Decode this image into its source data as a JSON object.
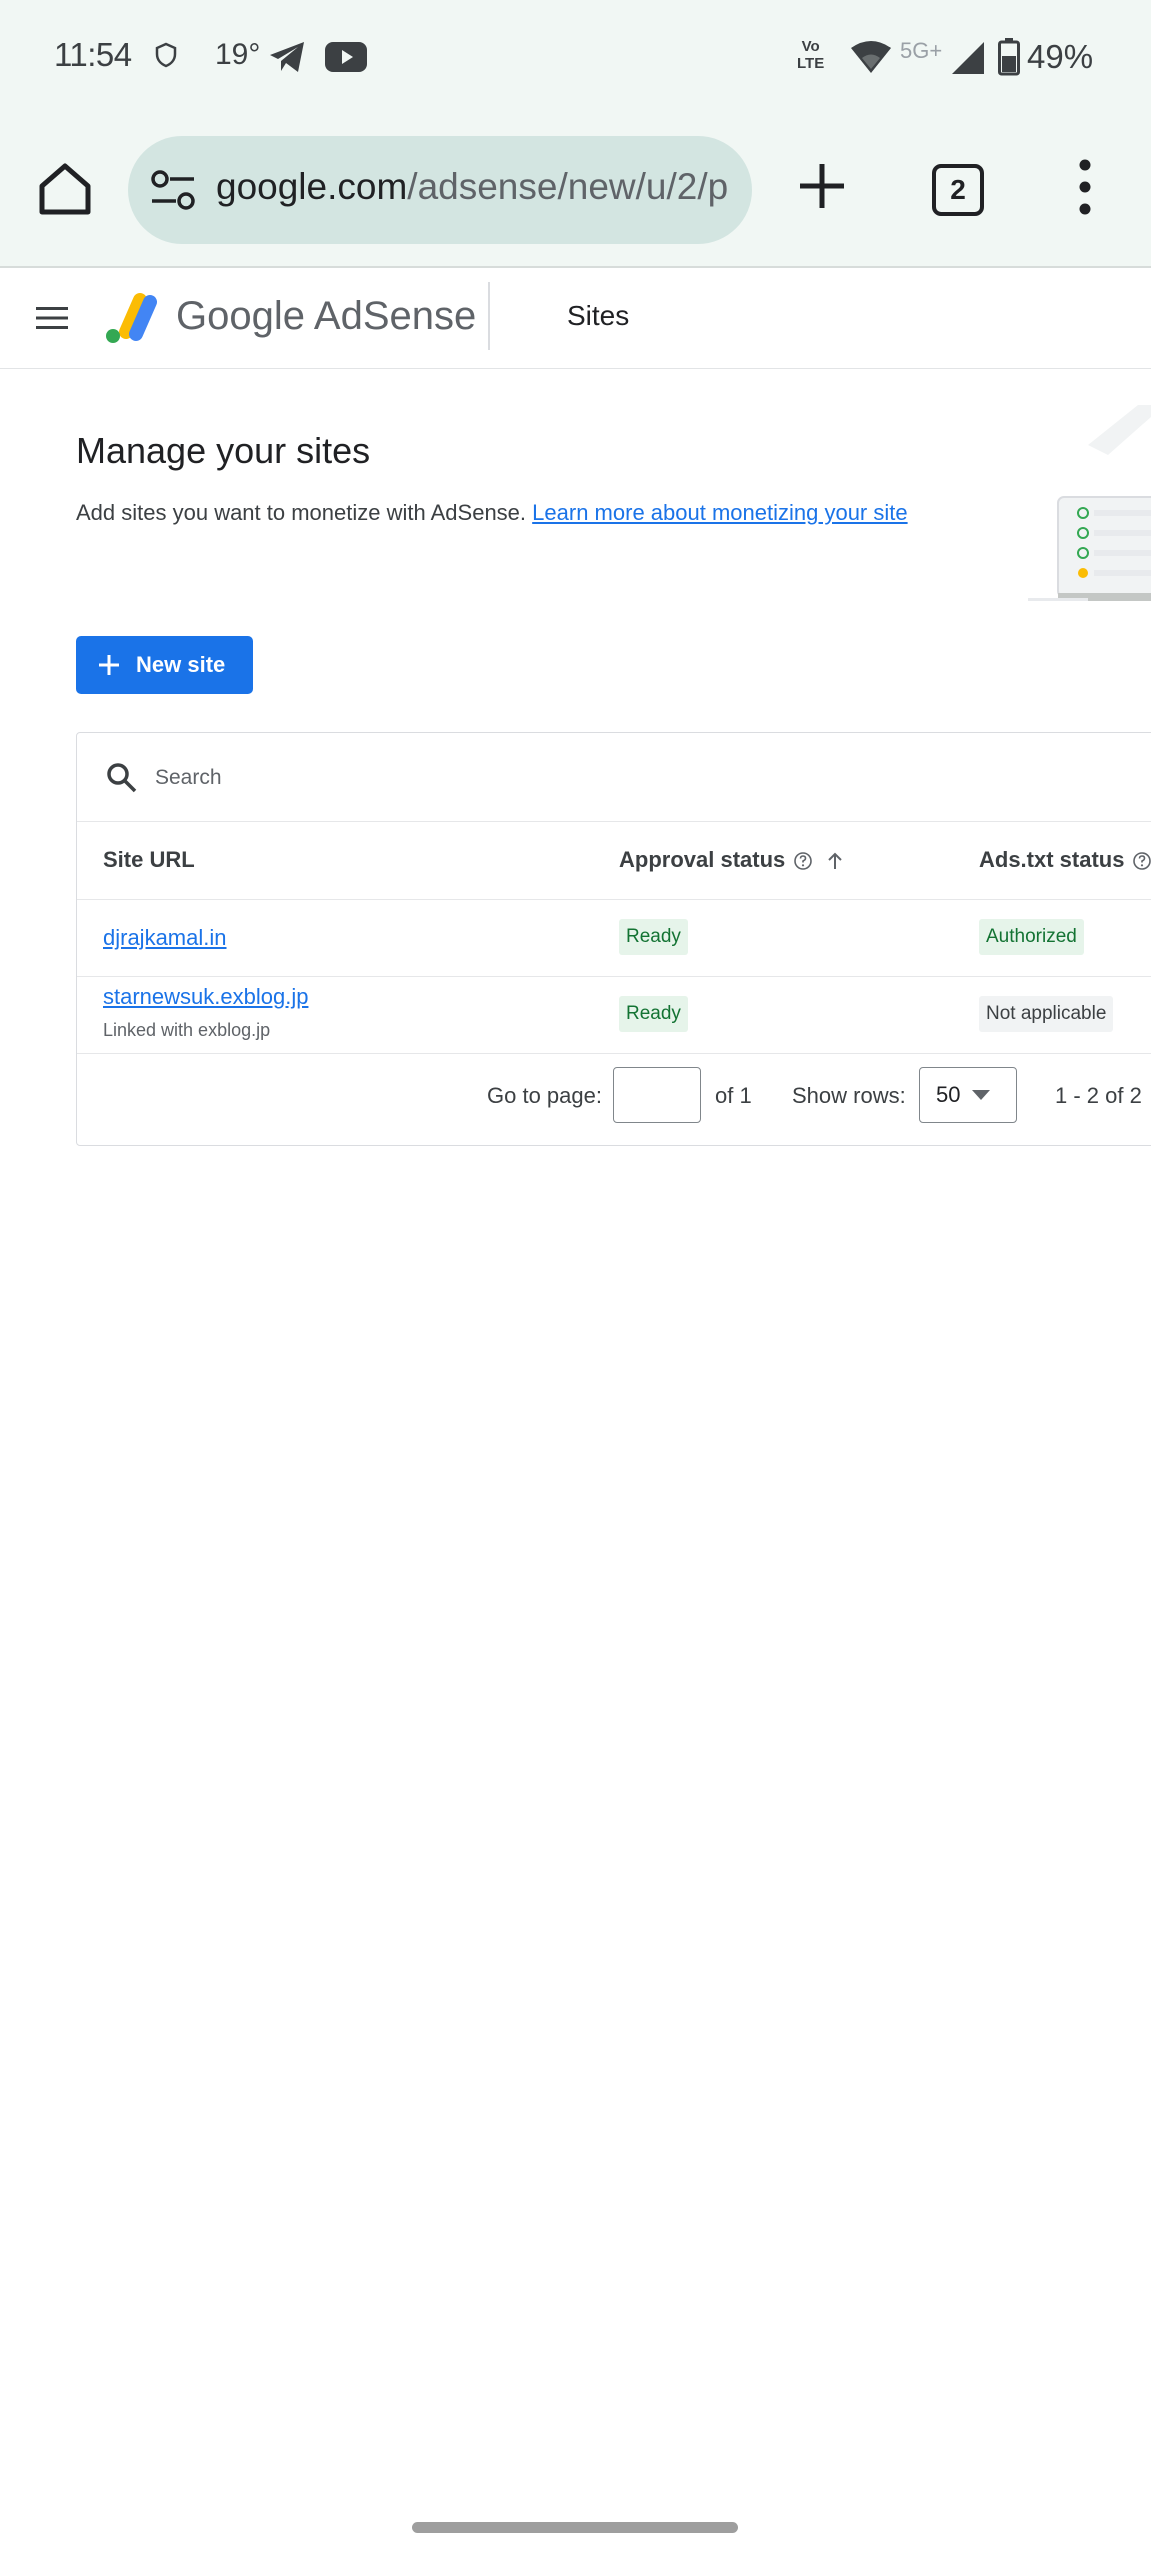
{
  "status_bar": {
    "time": "11:54",
    "temperature": "19°",
    "volte_line1": "Vo",
    "volte_line2": "LTE",
    "network": "5G+",
    "battery": "49%",
    "icons": [
      "shield-icon",
      "telegram-icon",
      "youtube-icon",
      "wifi-icon",
      "signal-icon",
      "battery-icon"
    ]
  },
  "browser": {
    "url_host": "google.com",
    "url_path": "/adsense/new/u/2/p",
    "tab_count": "2",
    "icons": [
      "home-icon",
      "tune-icon",
      "plus-icon",
      "tabs-icon",
      "more-vert-icon"
    ]
  },
  "adsense_header": {
    "brand_google": "Google",
    "brand_product": "AdSense",
    "section": "Sites",
    "colors": {
      "yellow": "#fbbc04",
      "green": "#34a853",
      "blue": "#4285f4"
    }
  },
  "main": {
    "title": "Manage your sites",
    "description": "Add sites you want to monetize with AdSense.",
    "learn_more_link": "Learn more about monetizing your site",
    "new_site_label": "New site",
    "accent_color": "#1a73e8"
  },
  "table": {
    "search_placeholder": "Search",
    "columns": {
      "site_url": "Site URL",
      "approval_status": "Approval status",
      "ads_txt_status": "Ads.txt status"
    },
    "rows": [
      {
        "url": "djrajkamal.in",
        "sub": "",
        "approval": "Ready",
        "ads_txt": "Authorized"
      },
      {
        "url": "starnewsuk.exblog.jp",
        "sub": "Linked with exblog.jp",
        "approval": "Ready",
        "ads_txt": "Not applicable"
      }
    ]
  },
  "pagination": {
    "go_to_page_label": "Go to page:",
    "of_pages": "of 1",
    "show_rows_label": "Show rows:",
    "rows_value": "50",
    "range": "1 - 2 of 2"
  }
}
